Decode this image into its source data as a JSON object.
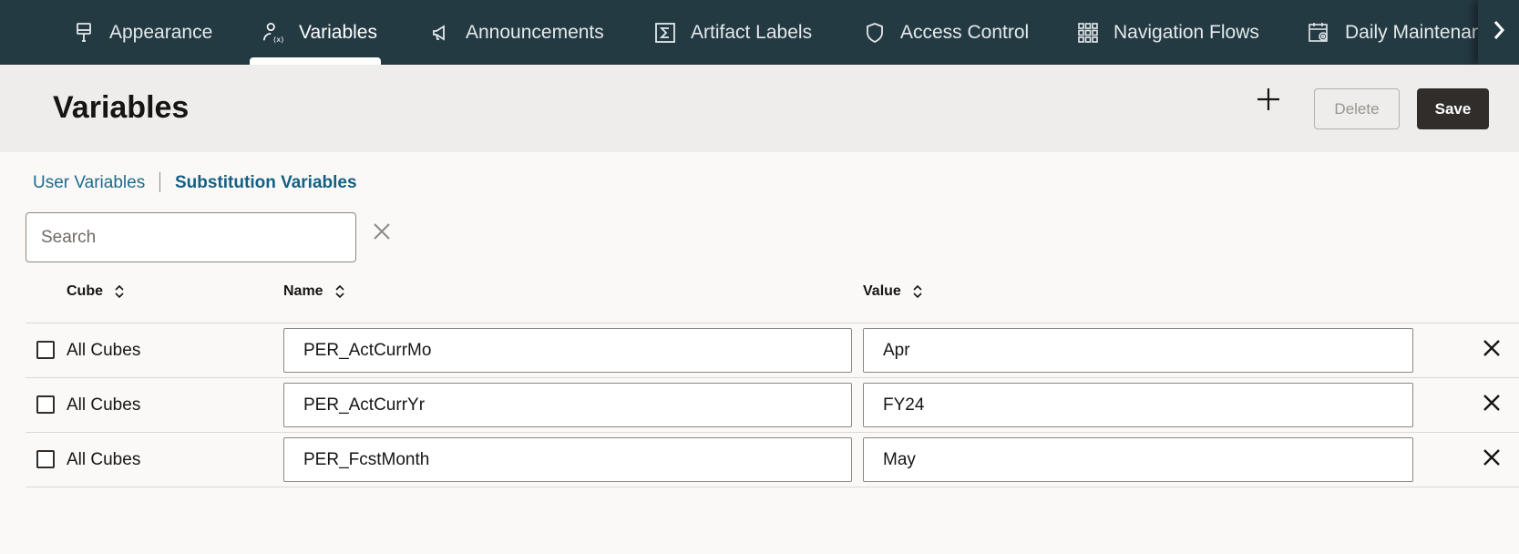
{
  "nav": {
    "items": [
      {
        "label": "Appearance",
        "icon": "paintbrush-icon"
      },
      {
        "label": "Variables",
        "icon": "user-variable-icon",
        "active": true
      },
      {
        "label": "Announcements",
        "icon": "megaphone-icon"
      },
      {
        "label": "Artifact Labels",
        "icon": "sigma-icon"
      },
      {
        "label": "Access Control",
        "icon": "shield-icon"
      },
      {
        "label": "Navigation Flows",
        "icon": "grid-icon"
      },
      {
        "label": "Daily Maintenance",
        "icon": "calendar-gear-icon"
      }
    ],
    "next_icon": "chevron-right-icon"
  },
  "header": {
    "title": "Variables",
    "add_icon": "plus-icon",
    "delete_label": "Delete",
    "save_label": "Save"
  },
  "subtabs": [
    {
      "label": "User Variables"
    },
    {
      "label": "Substitution Variables",
      "active": true
    }
  ],
  "search": {
    "placeholder": "Search"
  },
  "table": {
    "columns": [
      {
        "label": "Cube"
      },
      {
        "label": "Name"
      },
      {
        "label": "Value"
      }
    ],
    "rows": [
      {
        "cube": "All Cubes",
        "name": "PER_ActCurrMo",
        "value": "Apr"
      },
      {
        "cube": "All Cubes",
        "name": "PER_ActCurrYr",
        "value": "FY24"
      },
      {
        "cube": "All Cubes",
        "name": "PER_FcstMonth",
        "value": "May"
      }
    ]
  },
  "colors": {
    "nav_bg": "#243a43",
    "header_bg": "#efedeb",
    "link": "#146085",
    "save_bg": "#312d2a"
  }
}
